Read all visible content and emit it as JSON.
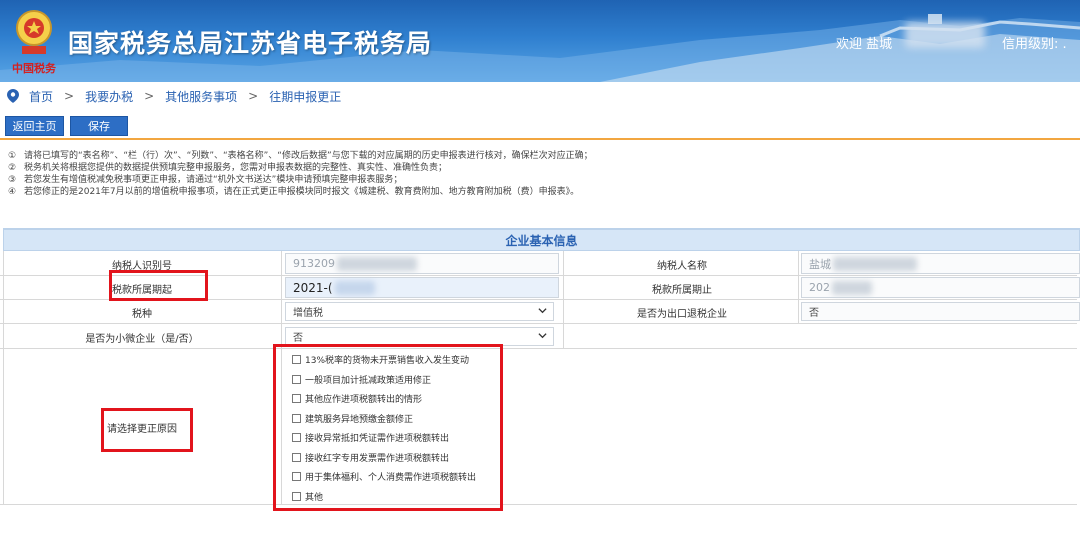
{
  "header": {
    "title": "国家税务总局江苏省电子税务局",
    "welcome": "欢迎 盐城",
    "credit_label": "信用级别: ."
  },
  "breadcrumb": [
    "首页",
    "我要办税",
    "其他服务事项",
    "往期申报更正"
  ],
  "toolbar": {
    "home_label": "返回主页",
    "save_label": "保存"
  },
  "notices": [
    "请将已填写的“表名称”、“栏（行）次”、“列数”、“表格名称”、“修改后数据”与您下载的对应属期的历史申报表进行核对，确保栏次对应正确；",
    "税务机关将根据您提供的数据提供预填完整申报服务，您需对申报表数据的完整性、真实性、准确性负责；",
    "若您发生有增值税减免税事项更正申报，请通过“机外文书送达”模块申请预填完整申报表服务；",
    "若您修正的是2021年7月以前的增值税申报事项，请在正式更正申报模块同时报文《城建税、教育费附加、地方教育附加税（费）申报表》。"
  ],
  "notice_markers": [
    "①",
    "②",
    "③",
    "④"
  ],
  "form": {
    "section_title": "企业基本信息",
    "taxpayer_id_label": "纳税人识别号",
    "taxpayer_id_value": "913209",
    "taxpayer_name_label": "纳税人名称",
    "taxpayer_name_value": "盐城",
    "period_start_label": "税款所属期起",
    "period_start_value": "2021-(",
    "period_end_label": "税款所属期止",
    "period_end_value": "202",
    "tax_type_label": "税种",
    "tax_type_value": "增值税",
    "export_refund_label": "是否为出口退税企业",
    "export_refund_value": "否",
    "small_micro_label": "是否为小微企业（是/否）",
    "small_micro_value": "否",
    "reason_label": "请选择更正原因",
    "reasons": [
      "13%税率的货物未开票销售收入发生变动",
      "一般项目加计抵减政策适用修正",
      "其他应作进项税额转出的情形",
      "建筑服务异地预缴金额修正",
      "接收异常抵扣凭证需作进项税额转出",
      "接收红字专用发票需作进项税额转出",
      "用于集体福利、个人消费需作进项税额转出",
      "其他"
    ]
  },
  "colors": {
    "accent": "#2d6ec5",
    "highlight": "#e2141c",
    "section_bg": "#d6e6f7"
  }
}
